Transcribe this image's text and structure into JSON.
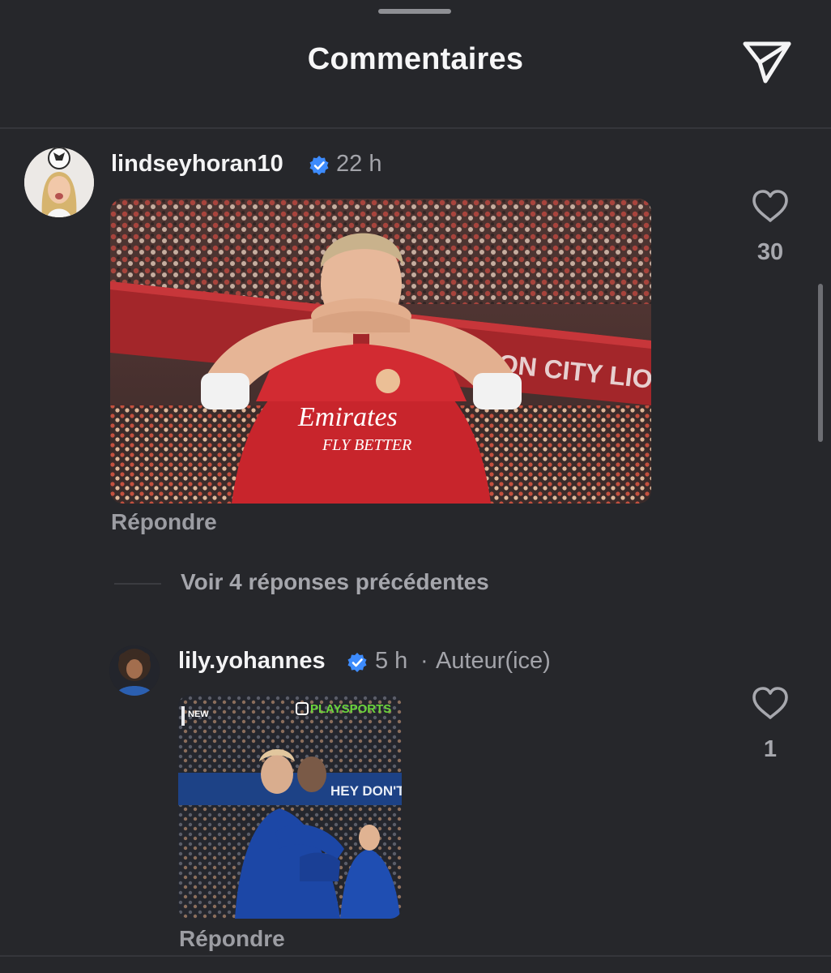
{
  "header": {
    "title": "Commentaires",
    "share_icon": "send-paper-plane-icon"
  },
  "comments": [
    {
      "username": "lindseyhoran10",
      "verified": true,
      "time": "22 h",
      "media": "gif-arsenal-player-celebration",
      "reply_label": "Répondre",
      "like_icon": "heart-outline-icon",
      "like_count": "30"
    }
  ],
  "thread": {
    "view_replies_label": "Voir 4 réponses précédentes"
  },
  "replies": [
    {
      "username": "lily.yohannes",
      "verified": true,
      "time": "5 h",
      "separator": "·",
      "author_badge": "Auteur(ice)",
      "media": "gif-chelsea-player-celebration",
      "reply_label": "Répondre",
      "like_icon": "heart-outline-icon",
      "like_count": "1"
    }
  ],
  "gif_text": {
    "sponsor": "Emirates",
    "sponsor_tagline": "FLY BETTER",
    "stadium_banner": "ON CITY LION",
    "broadcaster": "PLAYSPORTS",
    "corner_tag": "NEW",
    "chelsea_banner": "HEY DON'T"
  },
  "colors": {
    "background": "#26272b",
    "verified_blue": "#3d8bfd",
    "secondary_text": "#a3a4aa"
  }
}
